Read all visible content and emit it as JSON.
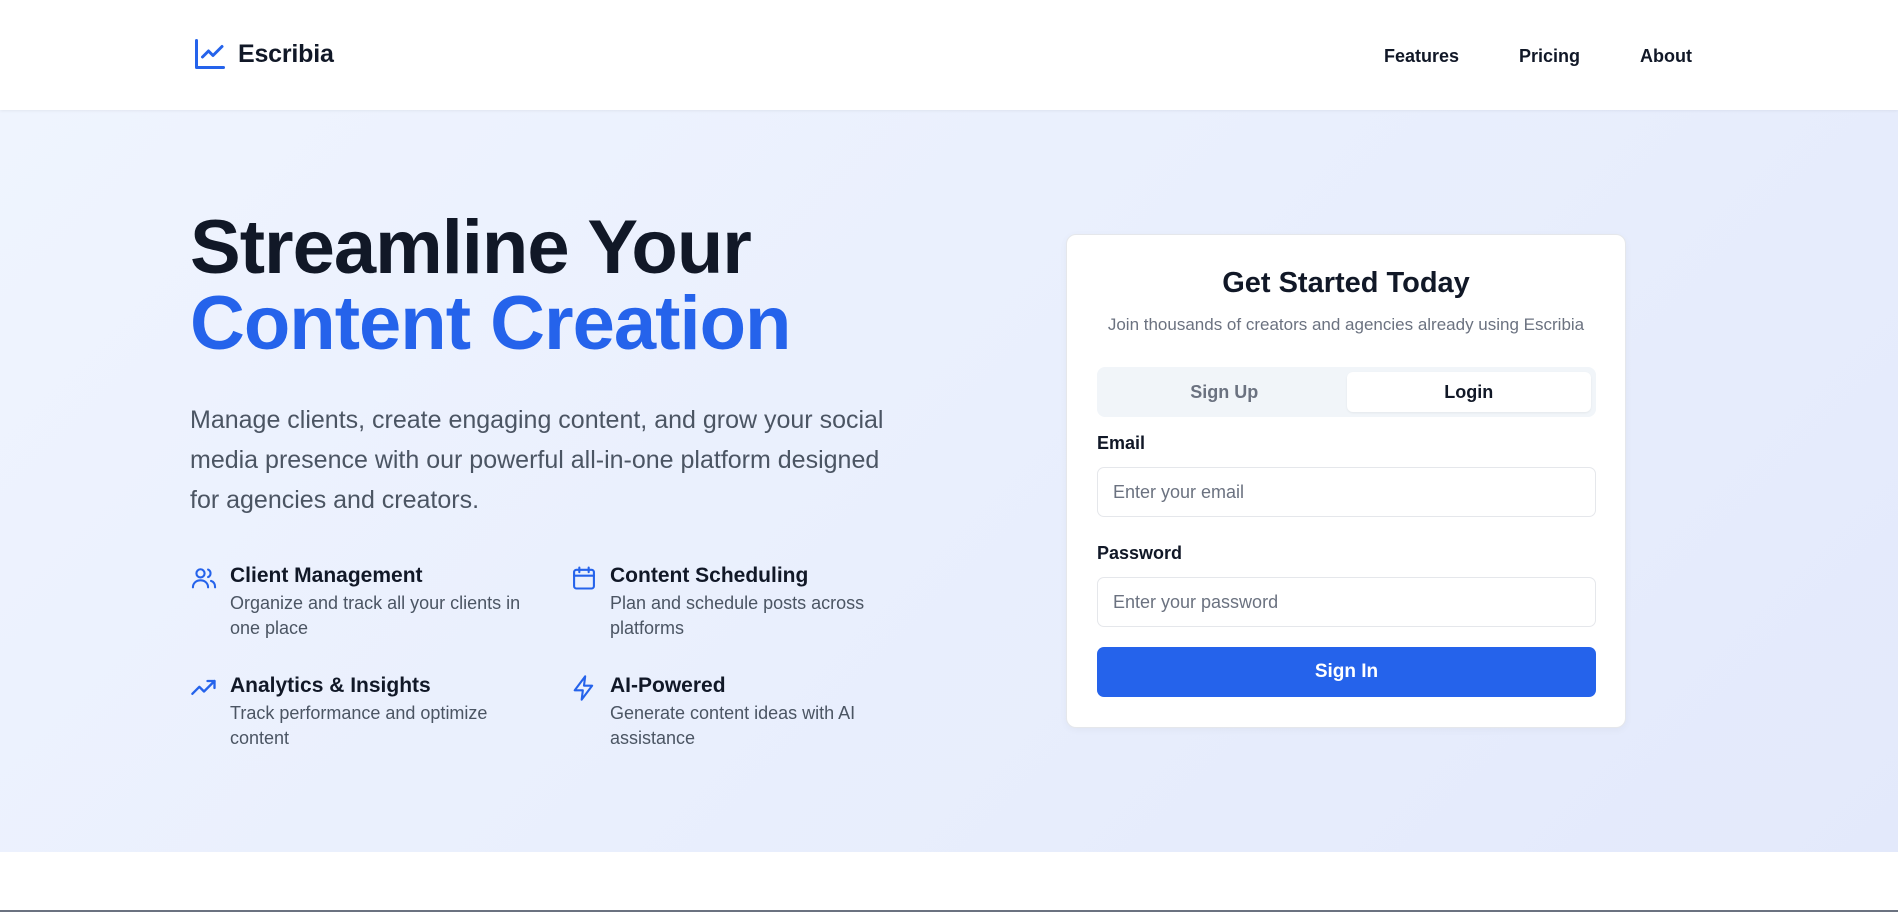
{
  "brand": {
    "name": "Escribia",
    "icon": "line-chart-icon"
  },
  "nav": {
    "links": [
      {
        "label": "Features"
      },
      {
        "label": "Pricing"
      },
      {
        "label": "About"
      }
    ]
  },
  "hero": {
    "headline_line1": "Streamline Your",
    "headline_line2": "Content Creation",
    "description": "Manage clients, create engaging content, and grow your social media presence with our powerful all-in-one platform designed for agencies and creators.",
    "features": [
      {
        "icon": "users-icon",
        "title": "Client Management",
        "desc": "Organize and track all your clients in one place"
      },
      {
        "icon": "calendar-icon",
        "title": "Content Scheduling",
        "desc": "Plan and schedule posts across platforms"
      },
      {
        "icon": "trending-up-icon",
        "title": "Analytics & Insights",
        "desc": "Track performance and optimize content"
      },
      {
        "icon": "lightning-icon",
        "title": "AI-Powered",
        "desc": "Generate content ideas with AI assistance"
      }
    ]
  },
  "auth": {
    "title": "Get Started Today",
    "subtitle": "Join thousands of creators and agencies already using Escribia",
    "tabs": [
      {
        "label": "Sign Up",
        "active": false
      },
      {
        "label": "Login",
        "active": true
      }
    ],
    "email_label": "Email",
    "email_value": "",
    "email_placeholder": "Enter your email",
    "password_label": "Password",
    "password_value": "",
    "password_placeholder": "Enter your password",
    "submit_label": "Sign In"
  },
  "colors": {
    "accent": "#2563eb",
    "text_dark": "#111827",
    "text_muted": "#4b5563",
    "hero_bg": "#eaf0fd"
  }
}
